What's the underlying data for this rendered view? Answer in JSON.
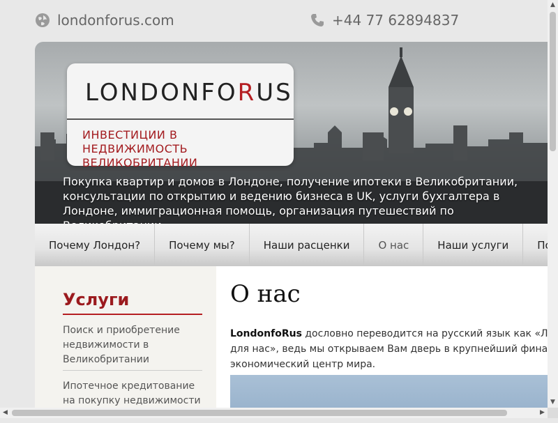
{
  "topbar": {
    "site": "londonforus.com",
    "phone": "+44 77 62894837",
    "site_icon": "globe-icon",
    "phone_icon": "phone-icon"
  },
  "logo": {
    "brand_start": "LONDONFO",
    "brand_accent": "R",
    "brand_end": "US",
    "tagline": "ИНВЕСТИЦИИ В НЕДВИЖИМОСТЬ ВЕЛИКОБРИТАНИИ"
  },
  "hero": {
    "description": "Покупка квартир и домов в Лондоне, получение ипотеки в Великобритании, консультации по открытию и ведению бизнеса в UK, услуги бухгалтера в Лондоне, иммиграционная помощь, организация путешествий по Великобритании"
  },
  "nav": {
    "items": [
      {
        "label": "Почему Лондон?"
      },
      {
        "label": "Почему мы?"
      },
      {
        "label": "Наши расценки"
      },
      {
        "label": "О нас"
      },
      {
        "label": "Наши услуги"
      },
      {
        "label": "Поле"
      }
    ],
    "active_index": 3
  },
  "sidebar": {
    "title": "Услуги",
    "items": [
      {
        "label": "Поиск и приобретение недвижимости в Великобритании"
      },
      {
        "label": "Ипотечное кредитование на покупку недвижимости в"
      }
    ]
  },
  "main": {
    "title": "О нас",
    "brand_bold": "LondonfoRus",
    "text": " дословно переводится на русский язык как «Лондон для нас», ведь мы открываем Вам дверь в крупнейший финансовый, экономический центр мира."
  },
  "colors": {
    "accent": "#b51e22",
    "background": "#e8e8e8"
  }
}
